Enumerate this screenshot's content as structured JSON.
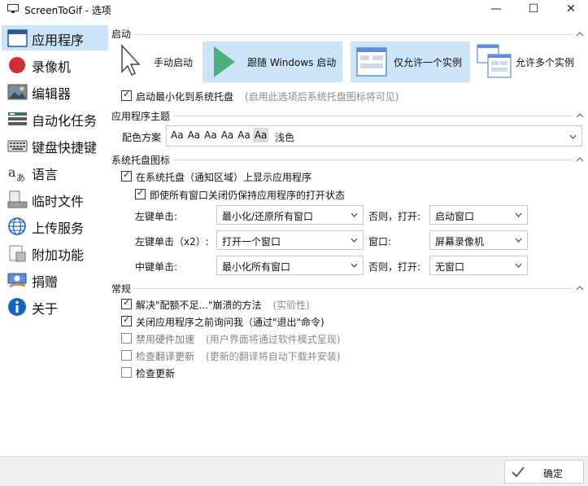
{
  "window": {
    "title": "ScreenToGif - 选项",
    "minimize_glyph": "—",
    "maximize_glyph": "☐",
    "close_glyph": "✕"
  },
  "sidebar": {
    "items": [
      {
        "label": "应用程序",
        "icon": "application-window-icon",
        "active": true
      },
      {
        "label": "录像机",
        "icon": "record-icon"
      },
      {
        "label": "编辑器",
        "icon": "editor-image-icon"
      },
      {
        "label": "自动化任务",
        "icon": "automation-tasks-icon"
      },
      {
        "label": "键盘快捷键",
        "icon": "keyboard-icon"
      },
      {
        "label": "语言",
        "icon": "language-icon"
      },
      {
        "label": "临时文件",
        "icon": "temp-files-icon"
      },
      {
        "label": "上传服务",
        "icon": "globe-upload-icon"
      },
      {
        "label": "附加功能",
        "icon": "extras-icon"
      },
      {
        "label": "捐赠",
        "icon": "donate-icon"
      },
      {
        "label": "关于",
        "icon": "info-icon"
      }
    ]
  },
  "startup": {
    "title": "启动",
    "buttons": [
      {
        "label": "手动启动",
        "icon": "cursor-icon",
        "selected": false
      },
      {
        "label": "跟随 Windows 启动",
        "icon": "play-icon",
        "selected": true
      },
      {
        "label": "仅允许一个实例",
        "icon": "single-instance-icon",
        "selected": true
      },
      {
        "label": "允许多个实例",
        "icon": "multiple-instances-icon",
        "selected": false
      }
    ],
    "minimize_tray": {
      "label": "启动最小化到系统托盘",
      "hint": "(启用此选项后系统托盘图标将可见)",
      "checked": true
    }
  },
  "theme": {
    "title": "应用程序主题",
    "label": "配色方案",
    "preview": [
      "Aa",
      "Aa",
      "Aa",
      "Aa",
      "Aa",
      "Aa"
    ],
    "value": "浅色"
  },
  "tray": {
    "title": "系统托盘图标",
    "show_in_tray": {
      "label": "在系统托盘（通知区域）上显示应用程序",
      "checked": true
    },
    "keep_open": {
      "label": "即使所有窗口关闭仍保持应用程序的打开状态",
      "checked": true
    },
    "rows": [
      {
        "label": "左键单击:",
        "value": "最小化/还原所有窗口",
        "else_label": "否则，打开:",
        "else_value": "启动窗口"
      },
      {
        "label": "左键单击（x2）:",
        "value": "打开一个窗口",
        "else_label": "窗口:",
        "else_value": "屏幕录像机"
      },
      {
        "label": "中键单击:",
        "value": "最小化所有窗口",
        "else_label": "否则，打开:",
        "else_value": "无窗口"
      }
    ]
  },
  "general": {
    "title": "常规",
    "items": [
      {
        "label": "解决\"配额不足...\"崩溃的方法",
        "hint": "(实验性)",
        "checked": true
      },
      {
        "label": "关闭应用程序之前询问我（通过\"退出\"命令)",
        "hint": "",
        "checked": true
      },
      {
        "label": "禁用硬件加速",
        "hint": "(用户界面将通过软件模式呈现)",
        "checked": false
      },
      {
        "label": "检查翻译更新",
        "hint": "(更新的翻译将自动下载并安装)",
        "checked": false
      },
      {
        "label": "检查更新",
        "hint": "",
        "checked": false
      }
    ]
  },
  "footer": {
    "ok_label": "确定"
  },
  "colors": {
    "selection": "#cce4f7",
    "play_green": "#4caf7d",
    "record_red": "#d32f2f",
    "info_blue": "#1565c0"
  }
}
